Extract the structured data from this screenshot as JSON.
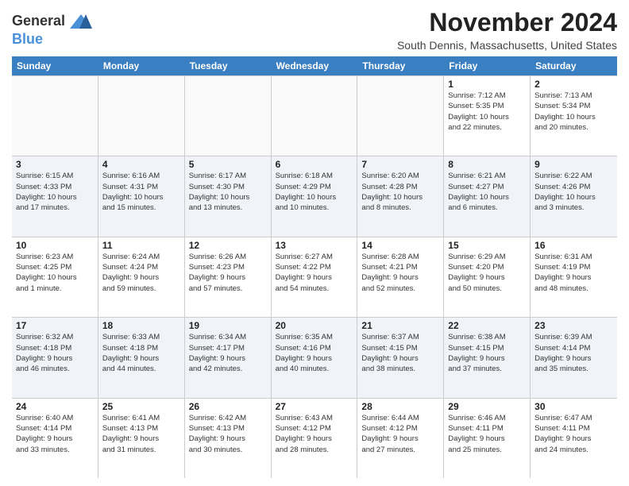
{
  "logo": {
    "line1": "General",
    "line2": "Blue"
  },
  "title": "November 2024",
  "subtitle": "South Dennis, Massachusetts, United States",
  "days_header": [
    "Sunday",
    "Monday",
    "Tuesday",
    "Wednesday",
    "Thursday",
    "Friday",
    "Saturday"
  ],
  "weeks": [
    [
      {
        "day": "",
        "info": ""
      },
      {
        "day": "",
        "info": ""
      },
      {
        "day": "",
        "info": ""
      },
      {
        "day": "",
        "info": ""
      },
      {
        "day": "",
        "info": ""
      },
      {
        "day": "1",
        "info": "Sunrise: 7:12 AM\nSunset: 5:35 PM\nDaylight: 10 hours\nand 22 minutes."
      },
      {
        "day": "2",
        "info": "Sunrise: 7:13 AM\nSunset: 5:34 PM\nDaylight: 10 hours\nand 20 minutes."
      }
    ],
    [
      {
        "day": "3",
        "info": "Sunrise: 6:15 AM\nSunset: 4:33 PM\nDaylight: 10 hours\nand 17 minutes."
      },
      {
        "day": "4",
        "info": "Sunrise: 6:16 AM\nSunset: 4:31 PM\nDaylight: 10 hours\nand 15 minutes."
      },
      {
        "day": "5",
        "info": "Sunrise: 6:17 AM\nSunset: 4:30 PM\nDaylight: 10 hours\nand 13 minutes."
      },
      {
        "day": "6",
        "info": "Sunrise: 6:18 AM\nSunset: 4:29 PM\nDaylight: 10 hours\nand 10 minutes."
      },
      {
        "day": "7",
        "info": "Sunrise: 6:20 AM\nSunset: 4:28 PM\nDaylight: 10 hours\nand 8 minutes."
      },
      {
        "day": "8",
        "info": "Sunrise: 6:21 AM\nSunset: 4:27 PM\nDaylight: 10 hours\nand 6 minutes."
      },
      {
        "day": "9",
        "info": "Sunrise: 6:22 AM\nSunset: 4:26 PM\nDaylight: 10 hours\nand 3 minutes."
      }
    ],
    [
      {
        "day": "10",
        "info": "Sunrise: 6:23 AM\nSunset: 4:25 PM\nDaylight: 10 hours\nand 1 minute."
      },
      {
        "day": "11",
        "info": "Sunrise: 6:24 AM\nSunset: 4:24 PM\nDaylight: 9 hours\nand 59 minutes."
      },
      {
        "day": "12",
        "info": "Sunrise: 6:26 AM\nSunset: 4:23 PM\nDaylight: 9 hours\nand 57 minutes."
      },
      {
        "day": "13",
        "info": "Sunrise: 6:27 AM\nSunset: 4:22 PM\nDaylight: 9 hours\nand 54 minutes."
      },
      {
        "day": "14",
        "info": "Sunrise: 6:28 AM\nSunset: 4:21 PM\nDaylight: 9 hours\nand 52 minutes."
      },
      {
        "day": "15",
        "info": "Sunrise: 6:29 AM\nSunset: 4:20 PM\nDaylight: 9 hours\nand 50 minutes."
      },
      {
        "day": "16",
        "info": "Sunrise: 6:31 AM\nSunset: 4:19 PM\nDaylight: 9 hours\nand 48 minutes."
      }
    ],
    [
      {
        "day": "17",
        "info": "Sunrise: 6:32 AM\nSunset: 4:18 PM\nDaylight: 9 hours\nand 46 minutes."
      },
      {
        "day": "18",
        "info": "Sunrise: 6:33 AM\nSunset: 4:18 PM\nDaylight: 9 hours\nand 44 minutes."
      },
      {
        "day": "19",
        "info": "Sunrise: 6:34 AM\nSunset: 4:17 PM\nDaylight: 9 hours\nand 42 minutes."
      },
      {
        "day": "20",
        "info": "Sunrise: 6:35 AM\nSunset: 4:16 PM\nDaylight: 9 hours\nand 40 minutes."
      },
      {
        "day": "21",
        "info": "Sunrise: 6:37 AM\nSunset: 4:15 PM\nDaylight: 9 hours\nand 38 minutes."
      },
      {
        "day": "22",
        "info": "Sunrise: 6:38 AM\nSunset: 4:15 PM\nDaylight: 9 hours\nand 37 minutes."
      },
      {
        "day": "23",
        "info": "Sunrise: 6:39 AM\nSunset: 4:14 PM\nDaylight: 9 hours\nand 35 minutes."
      }
    ],
    [
      {
        "day": "24",
        "info": "Sunrise: 6:40 AM\nSunset: 4:14 PM\nDaylight: 9 hours\nand 33 minutes."
      },
      {
        "day": "25",
        "info": "Sunrise: 6:41 AM\nSunset: 4:13 PM\nDaylight: 9 hours\nand 31 minutes."
      },
      {
        "day": "26",
        "info": "Sunrise: 6:42 AM\nSunset: 4:13 PM\nDaylight: 9 hours\nand 30 minutes."
      },
      {
        "day": "27",
        "info": "Sunrise: 6:43 AM\nSunset: 4:12 PM\nDaylight: 9 hours\nand 28 minutes."
      },
      {
        "day": "28",
        "info": "Sunrise: 6:44 AM\nSunset: 4:12 PM\nDaylight: 9 hours\nand 27 minutes."
      },
      {
        "day": "29",
        "info": "Sunrise: 6:46 AM\nSunset: 4:11 PM\nDaylight: 9 hours\nand 25 minutes."
      },
      {
        "day": "30",
        "info": "Sunrise: 6:47 AM\nSunset: 4:11 PM\nDaylight: 9 hours\nand 24 minutes."
      }
    ]
  ]
}
